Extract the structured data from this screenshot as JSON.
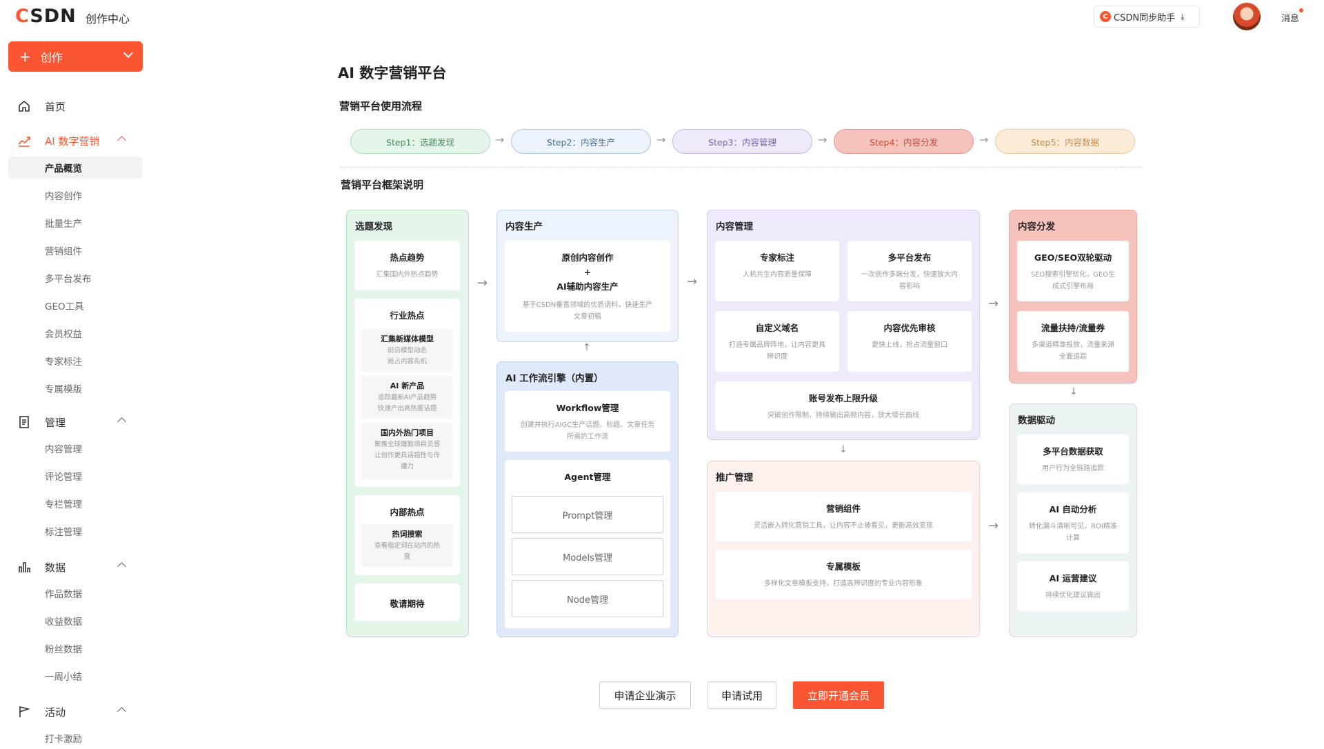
{
  "header": {
    "logo": "CSDN",
    "logo_c": "C",
    "logo_rest": "SDN",
    "site_title": "创作中心",
    "sync_btn": "CSDN同步助手",
    "sync_badge": "C",
    "messages": "消息"
  },
  "sidebar": {
    "create": "创作",
    "home": "首页",
    "ai_marketing": "AI 数字营销",
    "ai_sub": [
      "产品概览",
      "内容创作",
      "批量生产",
      "营销组件",
      "多平台发布",
      "GEO工具",
      "会员权益",
      "专家标注",
      "专属模版"
    ],
    "manage": "管理",
    "manage_sub": [
      "内容管理",
      "评论管理",
      "专栏管理",
      "标注管理"
    ],
    "data": "数据",
    "data_sub": [
      "作品数据",
      "收益数据",
      "粉丝数据",
      "一周小结"
    ],
    "activity": "活动",
    "activity_sub": [
      "打卡激励"
    ]
  },
  "main": {
    "title": "AI 数字营销平台",
    "flow_title": "营销平台使用流程",
    "steps": [
      "Step1：选题发现",
      "Step2：内容生产",
      "Step3：内容管理",
      "Step4：内容分发",
      "Step5：内容数据"
    ],
    "framework_title": "营销平台框架说明",
    "topic": {
      "title": "选题发现",
      "hot": {
        "t": "热点趋势",
        "d": "汇集国内外热点趋势"
      },
      "industry": {
        "t": "行业热点",
        "items": [
          {
            "t": "汇集新媒体模型",
            "d1": "前沿模型动态",
            "d2": "抢占内容先机"
          },
          {
            "t": "AI 新产品",
            "d1": "追踪最新AI产品趋势",
            "d2": "快速产出高热度话题"
          },
          {
            "t": "国内外热门项目",
            "d1": "聚焦全球爆款项目灵感",
            "d2": "让创作更具话题性与传",
            "d3": "播力"
          }
        ]
      },
      "internal": {
        "t": "内部热点",
        "sub_t": "热词搜索",
        "d1": "查看指定词在站内的热",
        "d2": "度"
      },
      "coming": "敬请期待"
    },
    "production": {
      "title": "内容生产",
      "c1": "原创内容创作",
      "plus": "+",
      "c2": "AI辅助内容生产",
      "d1": "基于CSDN垂直领域的优质语料，快速生产",
      "d2": "文章初稿"
    },
    "engine": {
      "title": "AI 工作流引擎（内置）",
      "wf_t": "Workflow管理",
      "wf_d1": "创建并执行AIGC生产话题、标题、文章任务",
      "wf_d2": "所需的工作流",
      "agent_t": "Agent管理",
      "btns": [
        "Prompt管理",
        "Models管理",
        "Node管理"
      ]
    },
    "management": {
      "title": "内容管理",
      "cards": [
        {
          "t": "专家标注",
          "d1": "人机共生内容质量保障",
          "d2": ""
        },
        {
          "t": "多平台发布",
          "d1": "一次创作多端分发，快速放大内",
          "d2": "容影响"
        },
        {
          "t": "自定义域名",
          "d1": "打造专属品牌阵地，让内容更具",
          "d2": "辨识度"
        },
        {
          "t": "内容优先审核",
          "d1": "更快上线，抢占流量窗口",
          "d2": ""
        }
      ],
      "wide": {
        "t": "账号发布上限升级",
        "d": "突破创作限制，持续输出高频内容，放大增长曲线"
      }
    },
    "promotion": {
      "title": "推广管理",
      "cards": [
        {
          "t": "营销组件",
          "d": "灵活嵌入转化营销工具，让内容不止被看见，更能高效变现"
        },
        {
          "t": "专属模板",
          "d": "多样化文章模板支持，打造高辨识度的专业内容形象"
        }
      ]
    },
    "distribution": {
      "title": "内容分发",
      "cards": [
        {
          "t": "GEO/SEO双轮驱动",
          "d1": "SEO搜索引擎优化，GEO生",
          "d2": "成式引擎布局"
        },
        {
          "t": "流量扶持/流量券",
          "d1": "多渠道精准投放，流量来源",
          "d2": "全面追踪"
        }
      ]
    },
    "data_driven": {
      "title": "数据驱动",
      "cards": [
        {
          "t": "多平台数据获取",
          "d1": "用户行为全链路追踪",
          "d2": ""
        },
        {
          "t": "AI 自动分析",
          "d1": "转化漏斗清晰可见，ROI精准",
          "d2": "计算"
        },
        {
          "t": "AI 运营建议",
          "d1": "持续优化建议输出",
          "d2": ""
        }
      ]
    },
    "cta": {
      "demo": "申请企业演示",
      "trial": "申请试用",
      "vip": "立即开通会员"
    }
  },
  "colors": {
    "accent": "#fc5531"
  }
}
